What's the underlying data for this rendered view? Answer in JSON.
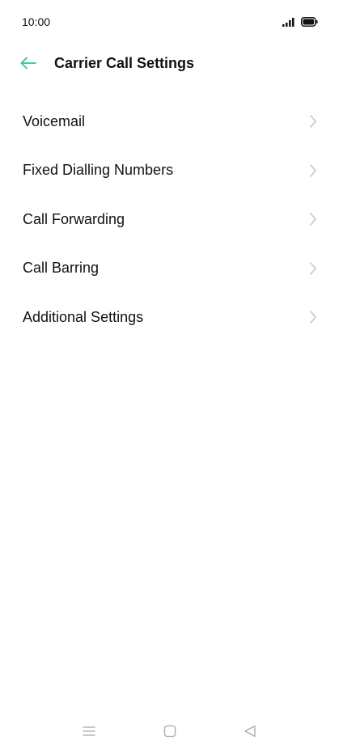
{
  "status_bar": {
    "time": "10:00",
    "signal_icon": "signal-icon",
    "battery_icon": "battery-icon"
  },
  "header": {
    "back_icon": "arrow-left-icon",
    "title": "Carrier Call Settings",
    "accent_color": "#2fc58c"
  },
  "menu": {
    "items": [
      {
        "label": "Voicemail"
      },
      {
        "label": "Fixed Dialling Numbers"
      },
      {
        "label": "Call Forwarding"
      },
      {
        "label": "Call Barring"
      },
      {
        "label": "Additional Settings"
      }
    ],
    "chevron_icon": "chevron-right-icon"
  },
  "nav_bar": {
    "menu_icon": "menu-icon",
    "home_icon": "home-square-icon",
    "back_icon": "back-triangle-icon"
  }
}
